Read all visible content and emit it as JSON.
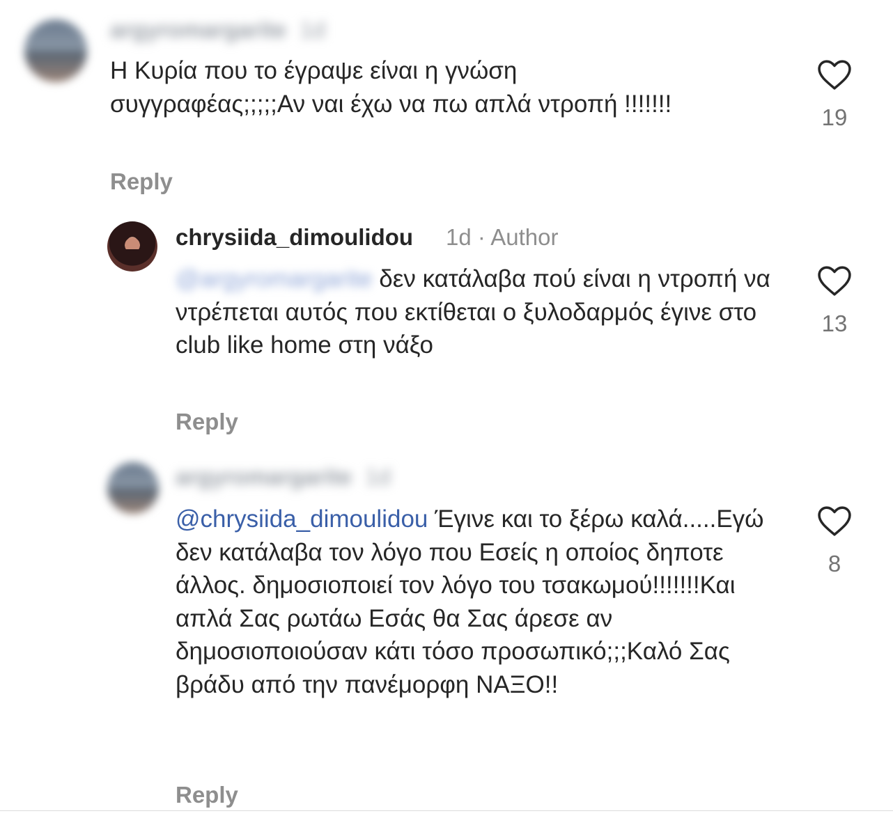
{
  "comments": [
    {
      "username": "argyromargarite",
      "time": "1d",
      "text": "Η Κυρία που το έγραψε είναι η γνώση συγγραφέας;;;;;Αν ναι έχω να πω απλά ντροπή !!!!!!!",
      "reply_label": "Reply",
      "likes": "19"
    },
    {
      "username": "chrysiida_dimoulidou",
      "time": "1d",
      "badge": "Author",
      "mention": "@argyromargarite",
      "text": " δεν κατάλαβα πού είναι η ντροπή να ντρέπεται αυτός που εκτίθεται ο ξυλοδαρμός έγινε στο club like home στη νάξο",
      "reply_label": "Reply",
      "likes": "13"
    },
    {
      "username": "argyromargarite",
      "time": "1d",
      "mention": "@chrysiida_dimoulidou",
      "text": " Έγινε και το ξέρω καλά.....Εγώ δεν κατάλαβα τον λόγο που Εσείς η οποίος δηποτε άλλος. δημοσιοποιεί τον λόγο του τσακωμού!!!!!!!Και απλά Σας ρωτάω Εσάς θα Σας άρεσε αν δημοσιοποιούσαν κάτι τόσο προσωπικό;;;Καλό Σας βράδυ από την πανέμορφη ΝΑΞΟ!!",
      "reply_label": "Reply",
      "likes": "8"
    }
  ],
  "icons": {
    "like": "heart-outline-icon"
  },
  "colors": {
    "text": "#262626",
    "secondary": "#8e8e8e",
    "mention": "#3a5fa8",
    "background": "#ffffff"
  }
}
